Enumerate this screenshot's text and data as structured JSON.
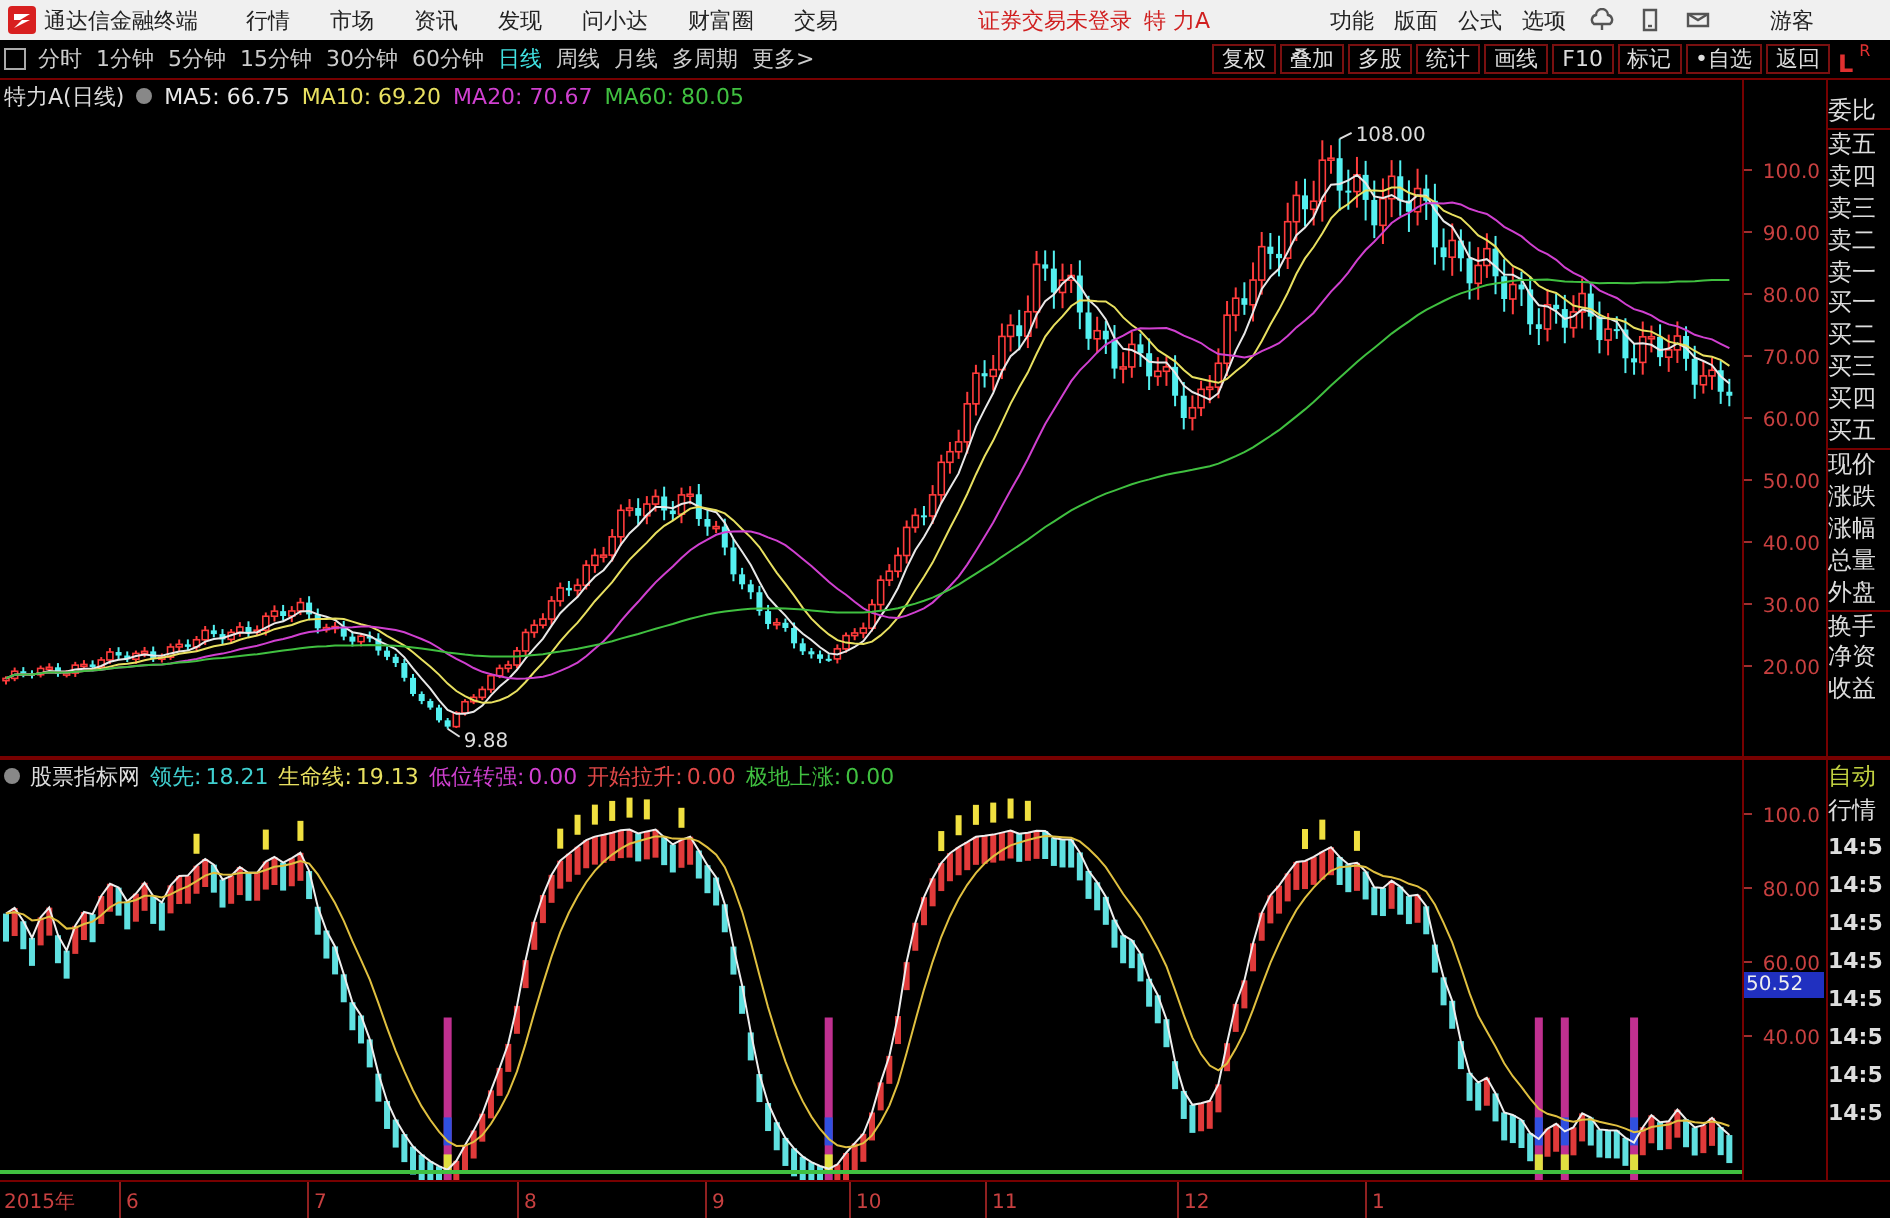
{
  "title_bar": {
    "app_name": "通达信金融终端",
    "menu": [
      "行情",
      "市场",
      "资讯",
      "发现",
      "问小达",
      "财富圈",
      "交易"
    ],
    "status": "证券交易未登录",
    "stock": "特 力A",
    "right_menu": [
      "功能",
      "版面",
      "公式",
      "选项"
    ],
    "user": "游客"
  },
  "toolbar": {
    "periods": [
      {
        "label": "分时",
        "selected": false
      },
      {
        "label": "1分钟",
        "selected": false
      },
      {
        "label": "5分钟",
        "selected": false
      },
      {
        "label": "15分钟",
        "selected": false
      },
      {
        "label": "30分钟",
        "selected": false
      },
      {
        "label": "60分钟",
        "selected": false
      },
      {
        "label": "日线",
        "selected": true
      },
      {
        "label": "周线",
        "selected": false
      },
      {
        "label": "月线",
        "selected": false
      },
      {
        "label": "多周期",
        "selected": false
      },
      {
        "label": "更多>",
        "selected": false
      }
    ],
    "tools": [
      "复权",
      "叠加",
      "多股",
      "统计",
      "画线",
      "F10",
      "标记",
      "•自选",
      "返回"
    ],
    "corner": [
      "L",
      "R"
    ]
  },
  "main_chart": {
    "title": "特力A(日线)",
    "indicators": [
      {
        "label": "MA5: 66.75",
        "color": "#e8e8e8"
      },
      {
        "label": "MA10: 69.20",
        "color": "#e8e060"
      },
      {
        "label": "MA20: 70.67",
        "color": "#d040d0"
      },
      {
        "label": "MA60: 80.05",
        "color": "#40c040"
      }
    ],
    "price_ticks": [
      "100.0",
      "90.00",
      "80.00",
      "70.00",
      "60.00",
      "50.00",
      "40.00",
      "30.00",
      "20.00"
    ],
    "high_label": "108.00",
    "low_label": "9.88"
  },
  "indicator_chart": {
    "title": "股票指标网",
    "indicators": [
      {
        "name": "领先:",
        "value": "18.21",
        "color": "#40d0d0"
      },
      {
        "name": "生命线:",
        "value": "19.13",
        "color": "#e8e060"
      },
      {
        "name": "低位转强:",
        "value": "0.00",
        "color": "#d040d0"
      },
      {
        "name": "开始拉升:",
        "value": "0.00",
        "color": "#e04848"
      },
      {
        "name": "极地上涨:",
        "value": "0.00",
        "color": "#40c040"
      }
    ],
    "ticks": [
      "100.0",
      "80.00",
      "60.00",
      "40.00"
    ],
    "current_value": "50.52"
  },
  "quote_panel": [
    "委比",
    "卖五",
    "卖四",
    "卖三",
    "卖二",
    "卖一",
    "买一",
    "买二",
    "买三",
    "买四",
    "买五",
    "现价",
    "涨跌",
    "涨幅",
    "总量",
    "外盘",
    "换手",
    "净资",
    "收益"
  ],
  "time_panel": {
    "labels": [
      "自动",
      "行情"
    ],
    "times": [
      "14:5",
      "14:5",
      "14:5",
      "14:5",
      "14:5",
      "14:5",
      "14:5",
      "14:5"
    ]
  },
  "date_axis": [
    "2015年",
    "6",
    "7",
    "8",
    "9",
    "10",
    "11",
    "12",
    "1"
  ]
}
